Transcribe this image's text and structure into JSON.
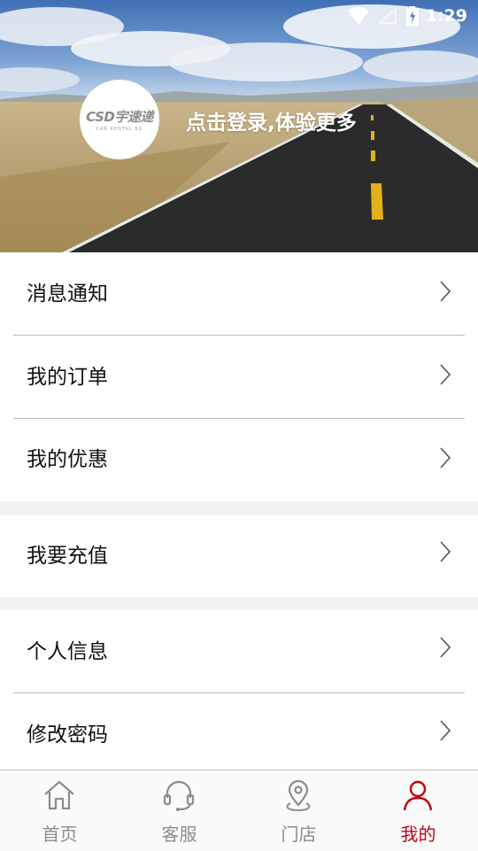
{
  "status_bar": {
    "time": "1:29"
  },
  "profile": {
    "logo_text": "CSD宇速递",
    "logo_subtext": "CAR RENTAL BG",
    "login_prompt": "点击登录,体验更多"
  },
  "menu_groups": [
    {
      "items": [
        {
          "label": "消息通知"
        },
        {
          "label": "我的订单"
        },
        {
          "label": "我的优惠"
        }
      ]
    },
    {
      "items": [
        {
          "label": "我要充值"
        }
      ]
    },
    {
      "items": [
        {
          "label": "个人信息"
        },
        {
          "label": "修改密码"
        }
      ]
    }
  ],
  "bottom_nav": {
    "items": [
      {
        "label": "首页",
        "icon": "home-icon"
      },
      {
        "label": "客服",
        "icon": "headset-icon"
      },
      {
        "label": "门店",
        "icon": "location-pin-icon"
      },
      {
        "label": "我的",
        "icon": "person-icon",
        "active": true
      }
    ],
    "active_color": "#c4000f",
    "inactive_color": "#8c8c8c"
  }
}
